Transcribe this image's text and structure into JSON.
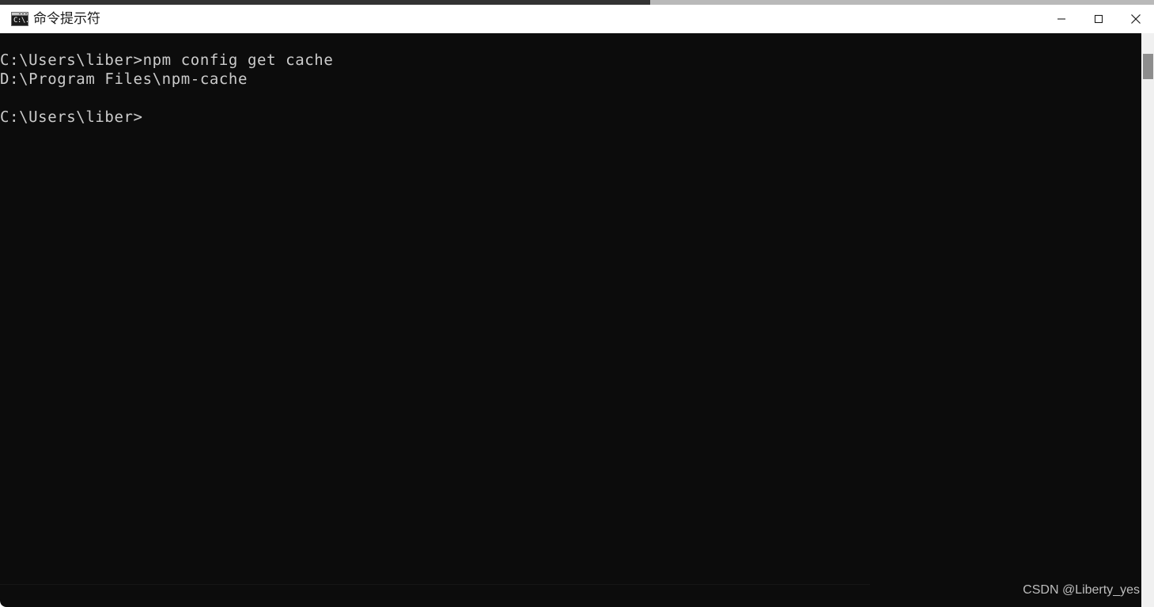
{
  "window": {
    "title": "命令提示符",
    "icon": "console-icon",
    "icon_glyph": "C:\\.",
    "background": "#0c0c0c",
    "titlebar_background": "#ffffff"
  },
  "caption": {
    "minimize_label": "最小化",
    "maximize_label": "最大化",
    "close_label": "关闭"
  },
  "console": {
    "foreground": "#cccccc",
    "lines": [
      "C:\\Users\\liber>npm config get cache",
      "D:\\Program Files\\npm-cache",
      "",
      "C:\\Users\\liber>"
    ],
    "text": "C:\\Users\\liber>npm config get cache\nD:\\Program Files\\npm-cache\n\nC:\\Users\\liber>",
    "command": "npm config get cache",
    "prompt": "C:\\Users\\liber>",
    "output": "D:\\Program Files\\npm-cache"
  },
  "scrollbar": {
    "track_color": "#f0f0f0",
    "thumb_color": "#8d8d8d"
  },
  "watermark": {
    "text": "CSDN @Liberty_yes",
    "color": "#bdbdbd"
  }
}
